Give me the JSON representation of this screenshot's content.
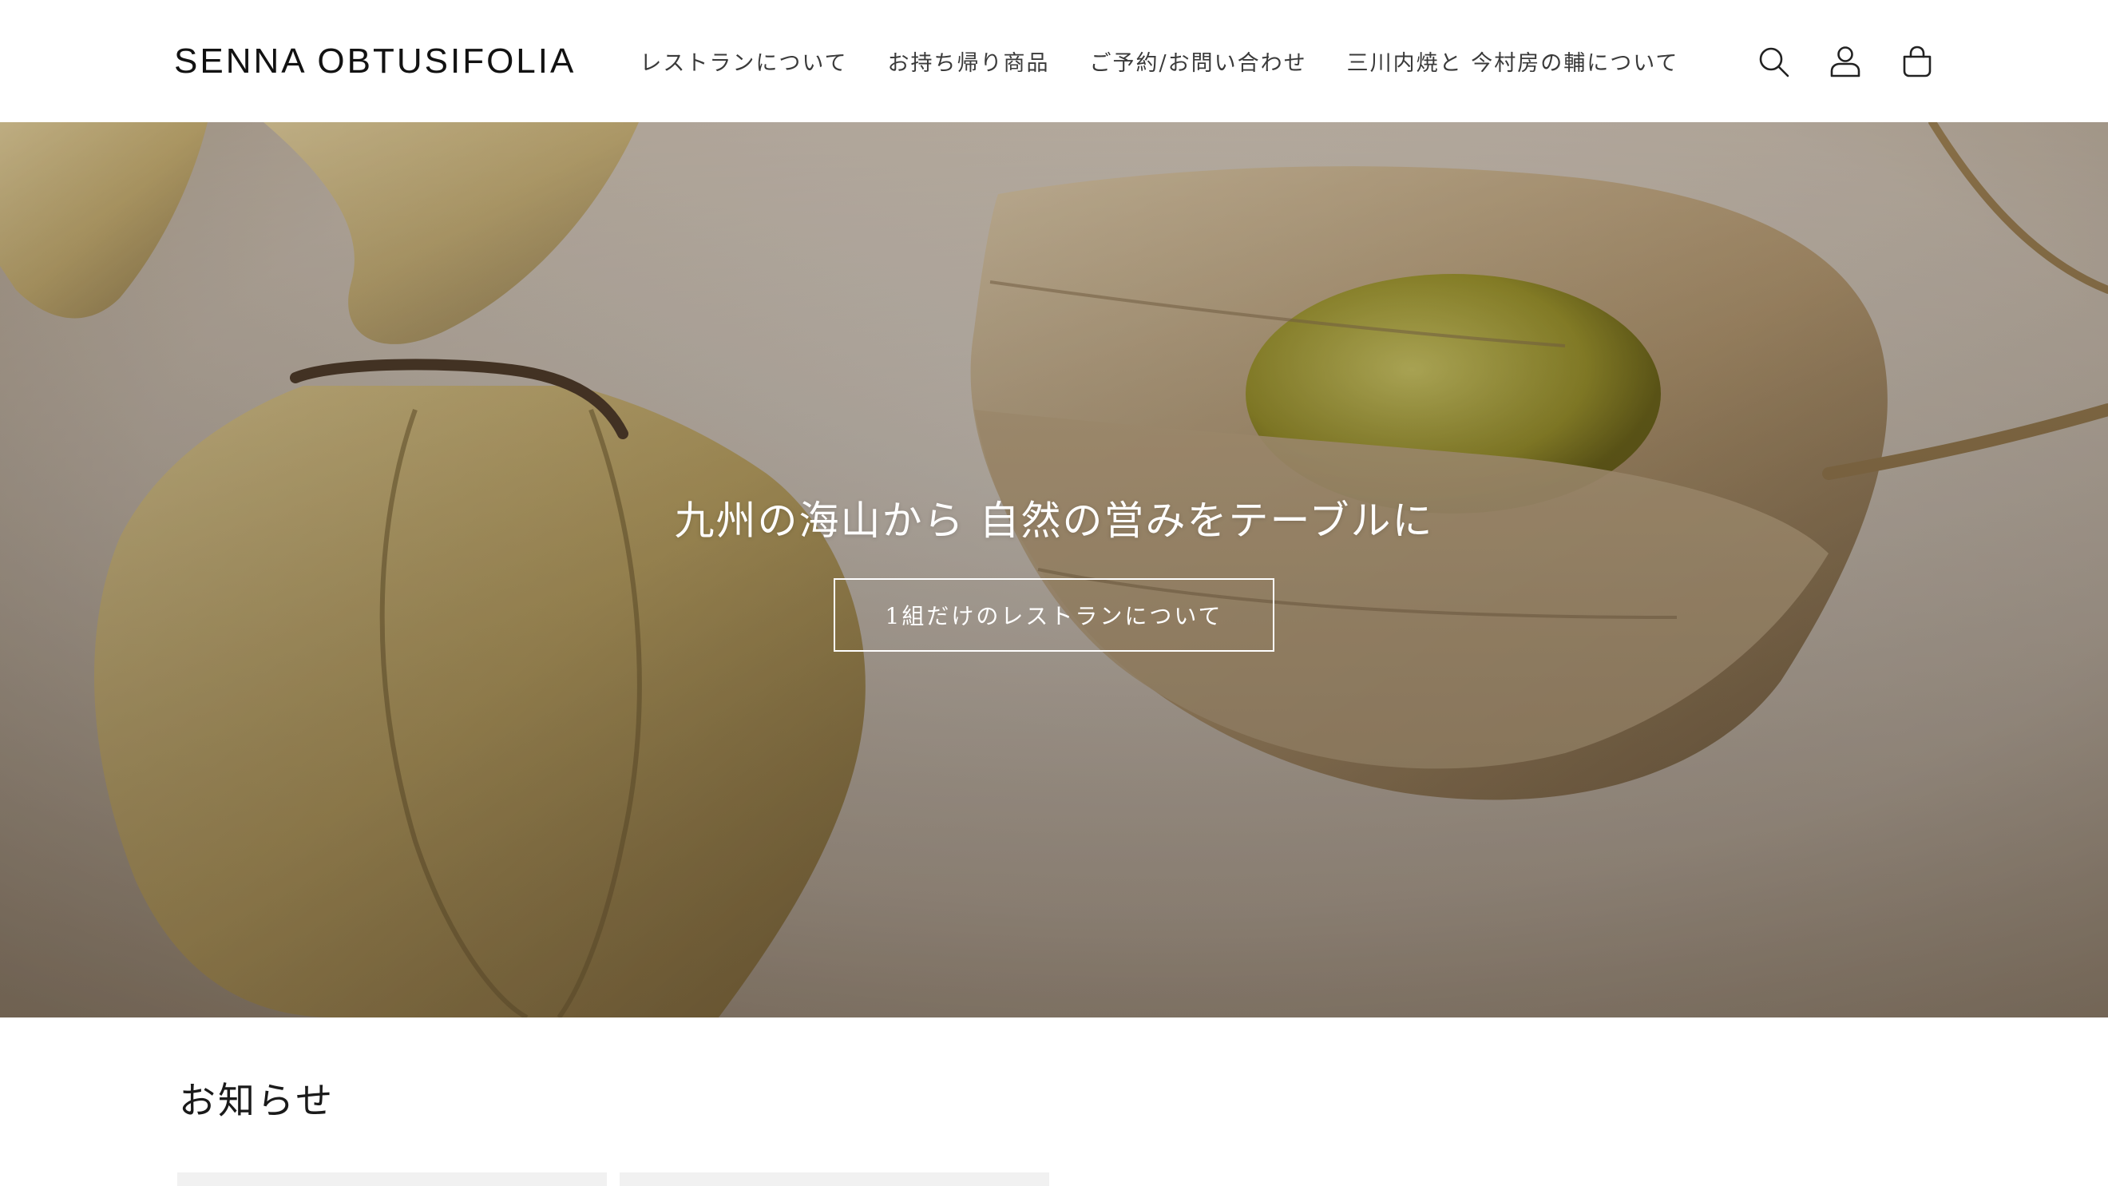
{
  "header": {
    "logo": "SENNA OBTUSIFOLIA",
    "nav": [
      {
        "label": "レストランについて"
      },
      {
        "label": "お持ち帰り商品"
      },
      {
        "label": "ご予約/お問い合わせ"
      },
      {
        "label": "三川内焼と 今村房の輔について"
      }
    ],
    "icons": [
      "search-icon",
      "account-icon",
      "cart-icon"
    ]
  },
  "hero": {
    "heading": "九州の海山から 自然の営みをテーブルに",
    "button_label": "1組だけのレストランについて"
  },
  "news": {
    "title": "お知らせ"
  },
  "colors": {
    "text": "#121212",
    "nav_text": "#3a3a3a",
    "hero_text": "#ffffff",
    "card_bg": "#f1f1f1"
  }
}
